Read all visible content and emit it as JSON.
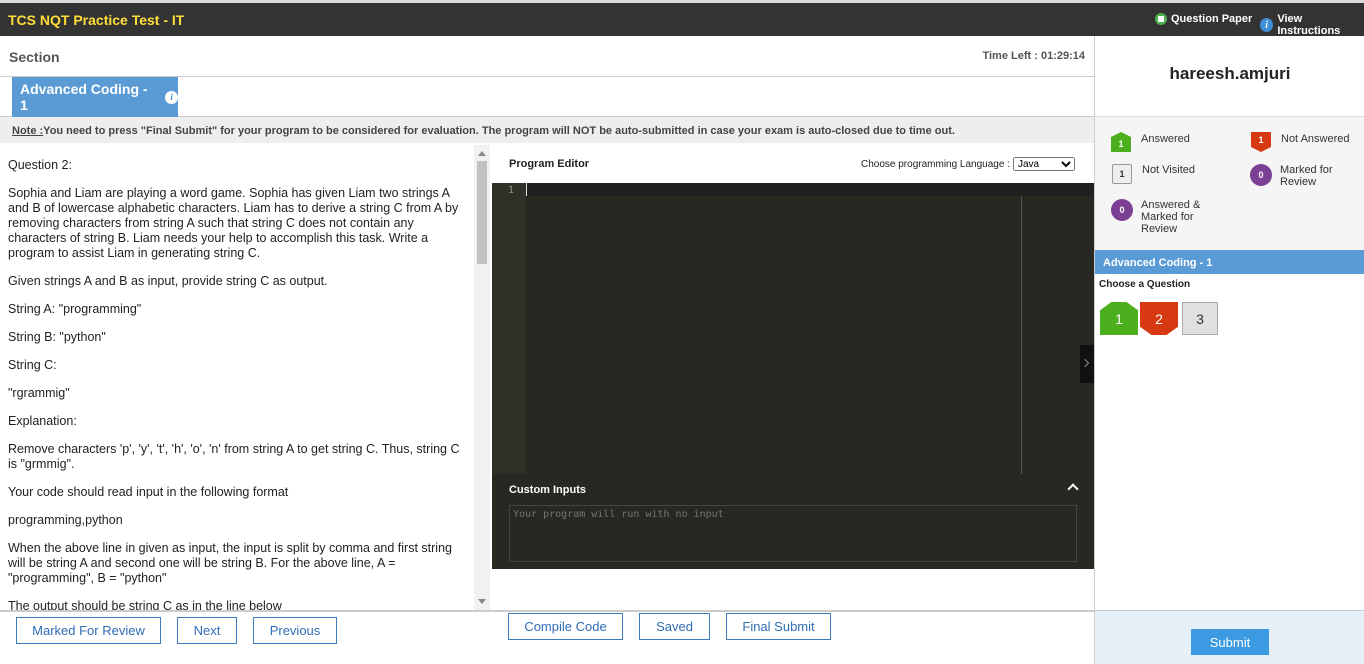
{
  "app": {
    "title": "TCS NQT Practice Test - IT",
    "question_paper_label": "Question Paper",
    "view_instructions_label": "View Instructions"
  },
  "section": {
    "label": "Section",
    "time_left": "Time Left : 01:29:14",
    "tab_label": "Advanced Coding - 1"
  },
  "note": {
    "prefix": "Note :",
    "text": "You need to press \"Final Submit\" for your program to be considered for evaluation. The program will NOT be auto-submitted in case your exam is auto-closed due to time out."
  },
  "question": {
    "paragraphs": [
      "Question 2:",
      "Sophia and Liam are playing a word game. Sophia has given Liam two strings A and B of lowercase alphabetic characters. Liam has to derive a string C from A by removing characters from string A such that string C does not contain any characters of string B. Liam needs your help to accomplish this task. Write a program to assist Liam in generating string C.",
      "Given strings A and B as input, provide string C as output.",
      "String A: \"programming\"",
      "String B: \"python\"",
      "String C:",
      "\"rgrammig\"",
      "Explanation:",
      "Remove characters 'p', 'y', 't', 'h', 'o', 'n' from string A to get string C. Thus, string C is \"grmmig\".",
      "Your code should read input in the following format",
      "programming,python",
      "When the above line in given as input, the input is split by comma and first string will be string A and second one will be string B. For the above line, A = \"programming\", B = \"python\"",
      "The output should be string C as in the line below"
    ]
  },
  "editor": {
    "title": "Program Editor",
    "language_label": "Choose programming Language :",
    "language_value": "Java",
    "line_number": "1",
    "custom_inputs_title": "Custom Inputs",
    "custom_inputs_placeholder": "Your program will run with no input"
  },
  "actions": {
    "compile": "Compile Code",
    "saved": "Saved",
    "final_submit": "Final Submit",
    "mark_review": "Marked For Review",
    "next": "Next",
    "previous": "Previous"
  },
  "user": {
    "name": "hareesh.amjuri"
  },
  "legend": {
    "answered": {
      "label": "Answered",
      "count": "1"
    },
    "not_answered": {
      "label": "Not Answered",
      "count": "1"
    },
    "not_visited": {
      "label": "Not Visited",
      "count": "1"
    },
    "marked": {
      "label": "Marked for Review",
      "count": "0"
    },
    "answered_marked": {
      "label": "Answered & Marked for Review",
      "count": "0"
    }
  },
  "palette": {
    "section_title": "Advanced Coding - 1",
    "choose_label": "Choose a Question",
    "questions": [
      "1",
      "2",
      "3"
    ]
  },
  "submit_label": "Submit"
}
